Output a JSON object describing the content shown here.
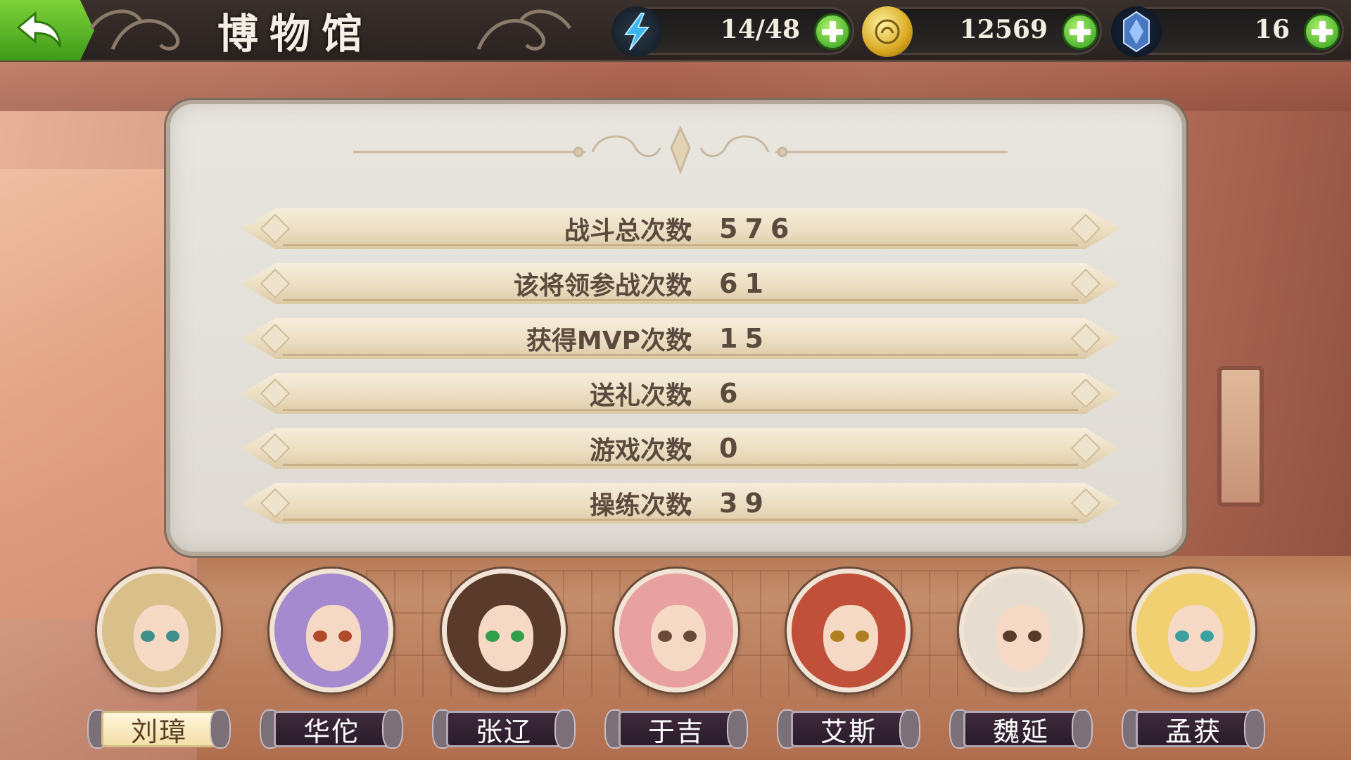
{
  "header": {
    "title": "博物馆",
    "back_label": "",
    "resources": [
      {
        "icon": "lightning-icon",
        "value": "14/48"
      },
      {
        "icon": "gold-coin-icon",
        "value": "12569"
      },
      {
        "icon": "crystal-icon",
        "value": "16"
      }
    ]
  },
  "stats": [
    {
      "label": "战斗总次数",
      "value": "576"
    },
    {
      "label": "该将领参战次数",
      "value": "61"
    },
    {
      "label": "获得MVP次数",
      "value": "15"
    },
    {
      "label": "送礼次数",
      "value": "6"
    },
    {
      "label": "游戏次数",
      "value": "0"
    },
    {
      "label": "操练次数",
      "value": "39"
    }
  ],
  "colon": "：",
  "characters": [
    {
      "name": "刘璋",
      "selected": true,
      "hair": "#d9c08a",
      "eyes": "#3f8f8a"
    },
    {
      "name": "华佗",
      "selected": false,
      "hair": "#a58ad0",
      "eyes": "#b04a2a"
    },
    {
      "name": "张辽",
      "selected": false,
      "hair": "#5a3a2a",
      "eyes": "#2ea04a"
    },
    {
      "name": "于吉",
      "selected": false,
      "hair": "#e8a0a0",
      "eyes": "#6a4a3a"
    },
    {
      "name": "艾斯",
      "selected": false,
      "hair": "#c0503a",
      "eyes": "#b08020"
    },
    {
      "name": "魏延",
      "selected": false,
      "hair": "#e6dccf",
      "eyes": "#5a3a2a"
    },
    {
      "name": "孟获",
      "selected": false,
      "hair": "#f0d070",
      "eyes": "#3aa0a0"
    }
  ],
  "colors": {
    "accent_green": "#3f9a18",
    "panel_bg": "#e6e2dc",
    "stat_text": "#5b4b3e"
  }
}
